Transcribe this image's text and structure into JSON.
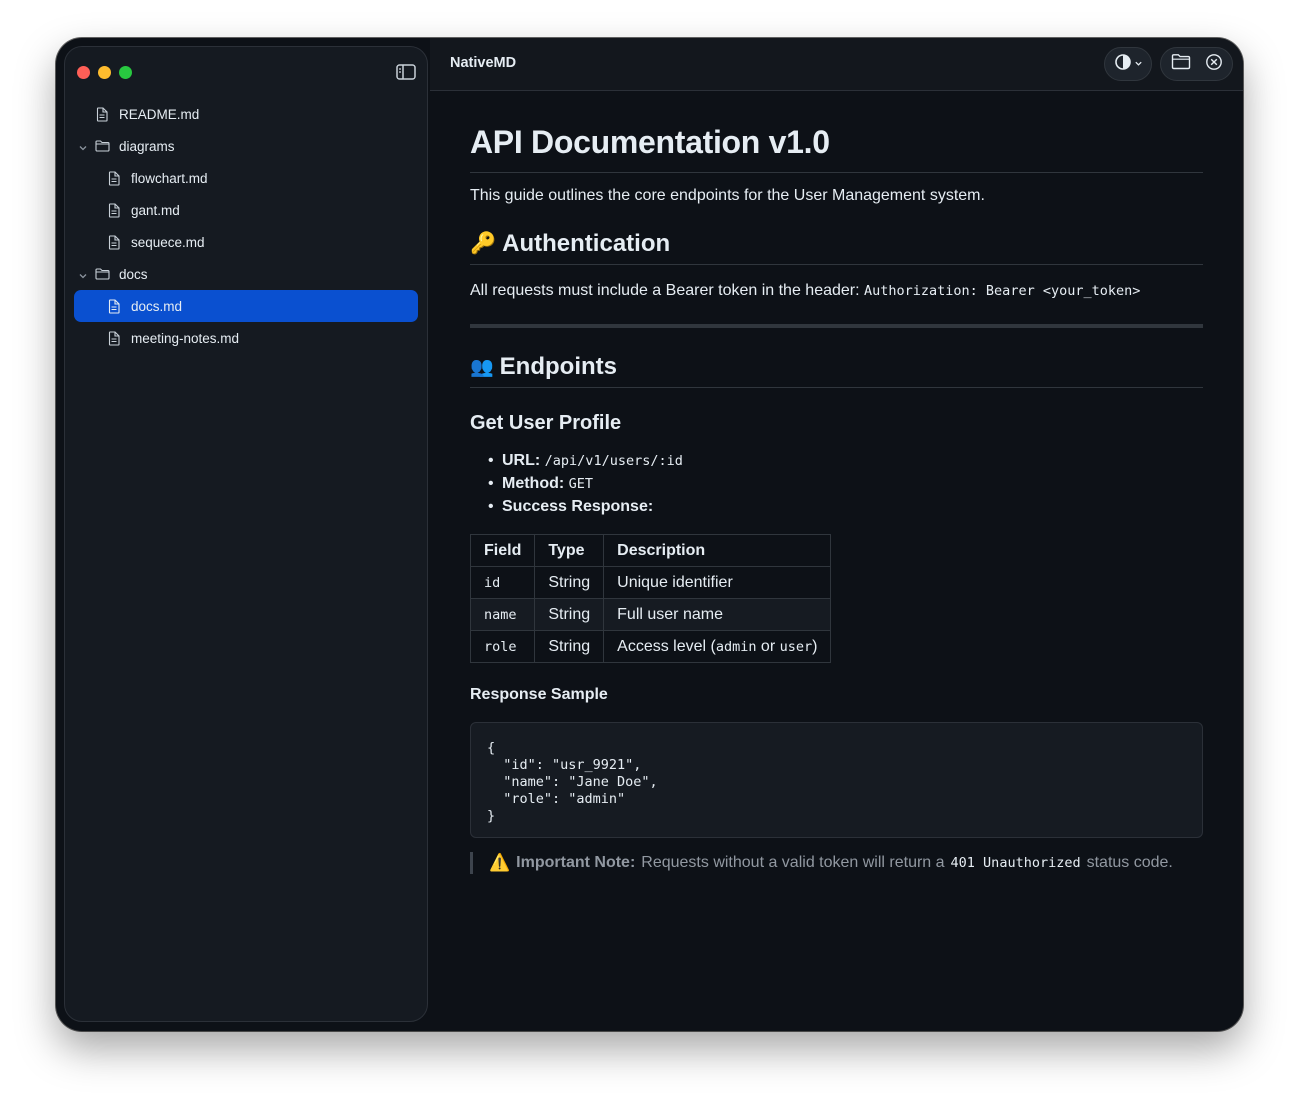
{
  "app": {
    "title": "NativeMD"
  },
  "sidebar": {
    "items": [
      {
        "label": "README.md",
        "type": "file",
        "level": 0
      },
      {
        "label": "diagrams",
        "type": "folder",
        "level": 0
      },
      {
        "label": "flowchart.md",
        "type": "file",
        "level": 1
      },
      {
        "label": "gant.md",
        "type": "file",
        "level": 1
      },
      {
        "label": "sequece.md",
        "type": "file",
        "level": 1
      },
      {
        "label": "docs",
        "type": "folder",
        "level": 0
      },
      {
        "label": "docs.md",
        "type": "file",
        "level": 1,
        "selected": true
      },
      {
        "label": "meeting-notes.md",
        "type": "file",
        "level": 1
      }
    ]
  },
  "toolbar": {
    "theme_icon": "contrast-icon",
    "open_icon": "folder-icon",
    "close_icon": "close-circle-icon"
  },
  "doc": {
    "h1": "API Documentation v1.0",
    "intro": "This guide outlines the core endpoints for the User Management system.",
    "auth": {
      "emoji": "🔑",
      "heading": "Authentication",
      "text": "All requests must include a Bearer token in the header:",
      "code": "Authorization: Bearer <your_token>"
    },
    "endpoints": {
      "emoji": "👥",
      "heading": "Endpoints"
    },
    "profile": {
      "heading": "Get User Profile",
      "url_label": "URL:",
      "url": "/api/v1/users/:id",
      "method_label": "Method:",
      "method": "GET",
      "response_label": "Success Response:"
    },
    "table": {
      "headers": [
        "Field",
        "Type",
        "Description"
      ],
      "rows": [
        {
          "field": "id",
          "type": "String",
          "desc": "Unique identifier"
        },
        {
          "field": "name",
          "type": "String",
          "desc": "Full user name"
        },
        {
          "field": "role",
          "type": "String",
          "desc_prefix": "Access level (",
          "code1": "admin",
          "desc_or": " or ",
          "code2": "user",
          "desc_suffix": ")"
        }
      ]
    },
    "sample": {
      "heading": "Response Sample",
      "code": "{\n  \"id\": \"usr_9921\",\n  \"name\": \"Jane Doe\",\n  \"role\": \"admin\"\n}"
    },
    "note": {
      "emoji": "⚠️",
      "label": "Important Note:",
      "text": "Requests without a valid token will return a",
      "code": "401 Unauthorized",
      "suffix": "status code."
    }
  }
}
